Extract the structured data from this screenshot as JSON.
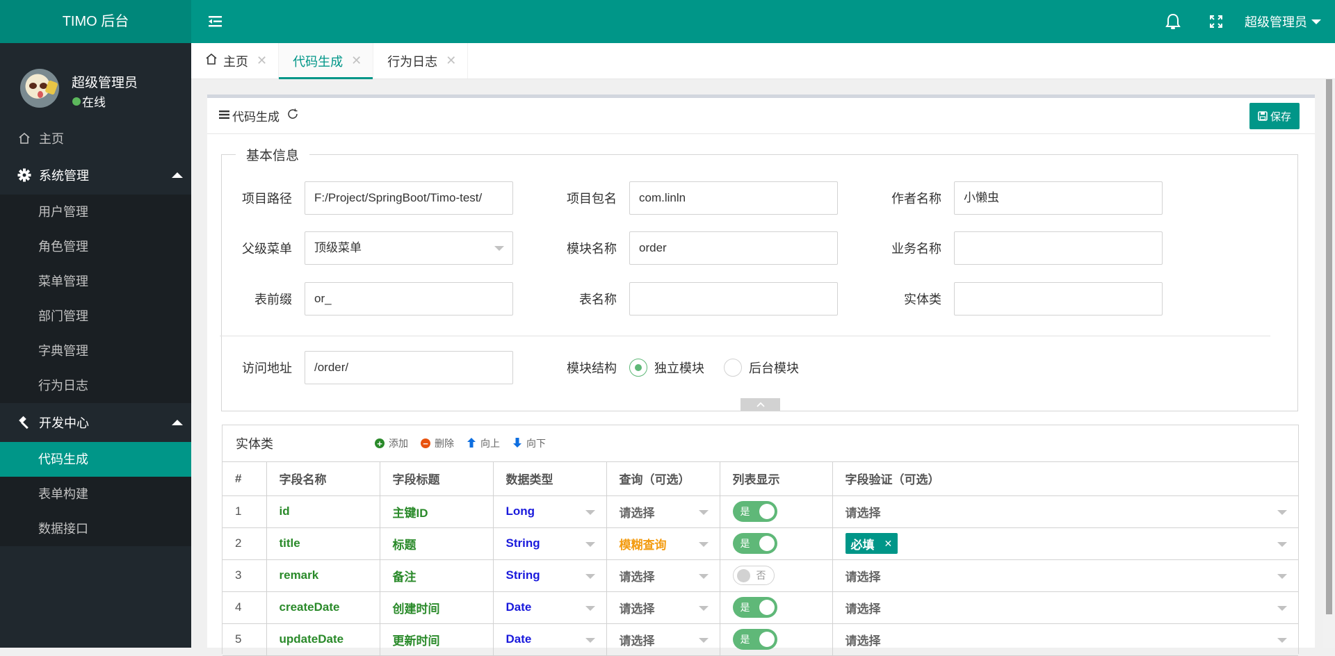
{
  "header": {
    "logo": "TIMO 后台",
    "user": "超级管理员",
    "icons": [
      "menu-toggle-icon",
      "bell-icon",
      "fullscreen-icon"
    ]
  },
  "sidebar": {
    "user_name": "超级管理员",
    "status": "在线",
    "home": "主页",
    "groups": [
      {
        "label": "系统管理",
        "icon": "gear-icon",
        "items": [
          "用户管理",
          "角色管理",
          "菜单管理",
          "部门管理",
          "字典管理",
          "行为日志"
        ]
      },
      {
        "label": "开发中心",
        "icon": "gavel-icon",
        "items": [
          "代码生成",
          "表单构建",
          "数据接口"
        ],
        "active": "代码生成"
      }
    ]
  },
  "tabs": [
    {
      "label": "主页",
      "active": false
    },
    {
      "label": "代码生成",
      "active": true
    },
    {
      "label": "行为日志",
      "active": false
    }
  ],
  "card": {
    "title": "代码生成",
    "save": "保存"
  },
  "basic": {
    "legend": "基本信息",
    "fields": {
      "project_path": {
        "label": "项目路径",
        "value": "F:/Project/SpringBoot/Timo-test/"
      },
      "package": {
        "label": "项目包名",
        "value": "com.linln"
      },
      "author": {
        "label": "作者名称",
        "value": "小懒虫"
      },
      "parent_menu": {
        "label": "父级菜单",
        "value": "顶级菜单"
      },
      "module": {
        "label": "模块名称",
        "value": "order"
      },
      "business": {
        "label": "业务名称",
        "value": ""
      },
      "prefix": {
        "label": "表前缀",
        "value": "or_"
      },
      "table": {
        "label": "表名称",
        "value": ""
      },
      "entity": {
        "label": "实体类",
        "value": ""
      },
      "url": {
        "label": "访问地址",
        "value": "/order/"
      }
    },
    "structure": {
      "label": "模块结构",
      "options": [
        "独立模块",
        "后台模块"
      ],
      "selected": "独立模块"
    }
  },
  "entity": {
    "title": "实体类",
    "actions": {
      "add": "添加",
      "delete": "删除",
      "up": "向上",
      "down": "向下"
    },
    "columns": [
      "#",
      "字段名称",
      "字段标题",
      "数据类型",
      "查询（可选）",
      "列表显示",
      "字段验证（可选）"
    ],
    "rows": [
      {
        "idx": "1",
        "name": "id",
        "title": "主键ID",
        "type": "Long",
        "query": "请选择",
        "query_set": false,
        "show": true,
        "show_label": "是",
        "verify": "请选择",
        "verify_tags": []
      },
      {
        "idx": "2",
        "name": "title",
        "title": "标题",
        "type": "String",
        "query": "模糊查询",
        "query_set": true,
        "show": true,
        "show_label": "是",
        "verify": "",
        "verify_tags": [
          "必填"
        ]
      },
      {
        "idx": "3",
        "name": "remark",
        "title": "备注",
        "type": "String",
        "query": "请选择",
        "query_set": false,
        "show": false,
        "show_label": "否",
        "verify": "请选择",
        "verify_tags": []
      },
      {
        "idx": "4",
        "name": "createDate",
        "title": "创建时间",
        "type": "Date",
        "query": "请选择",
        "query_set": false,
        "show": true,
        "show_label": "是",
        "verify": "请选择",
        "verify_tags": []
      },
      {
        "idx": "5",
        "name": "updateDate",
        "title": "更新时间",
        "type": "Date",
        "query": "请选择",
        "query_set": false,
        "show": true,
        "show_label": "是",
        "verify": "请选择",
        "verify_tags": []
      }
    ]
  },
  "colors": {
    "primary": "#009688",
    "sidebar": "#20282e",
    "switch_on": "#5fb878",
    "query_set": "#f39c12",
    "type": "#1a1adc",
    "field": "#2a8a2a"
  }
}
